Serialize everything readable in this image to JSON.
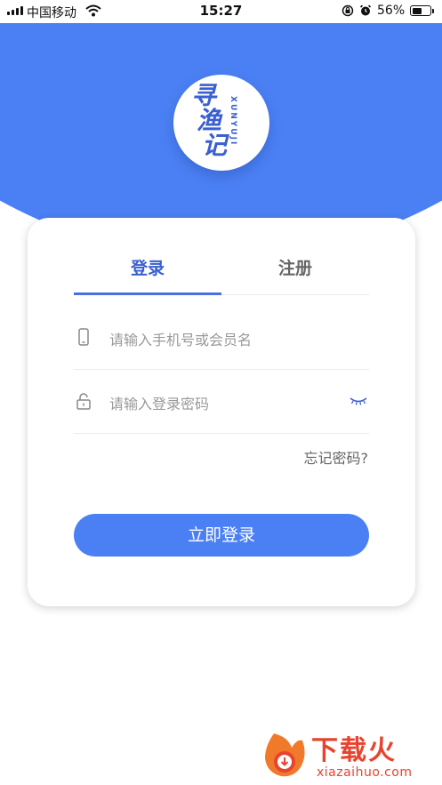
{
  "status_bar": {
    "carrier": "中国移动",
    "time": "15:27",
    "battery_percent": "56%",
    "battery_level": 0.56
  },
  "logo": {
    "chars": [
      "寻",
      "渔",
      "记"
    ],
    "latin": "XUNYUJI"
  },
  "tabs": [
    {
      "label": "登录",
      "active": true
    },
    {
      "label": "注册",
      "active": false
    }
  ],
  "form": {
    "phone_placeholder": "请输入手机号或会员名",
    "password_placeholder": "请输入登录密码",
    "forgot_label": "忘记密码?",
    "login_button": "立即登录"
  },
  "watermark": {
    "brand": "下载火",
    "url": "xiazaihuo.com"
  },
  "colors": {
    "primary": "#4b80f4",
    "tab_active": "#3a5fd0",
    "watermark": "#e8432e"
  }
}
